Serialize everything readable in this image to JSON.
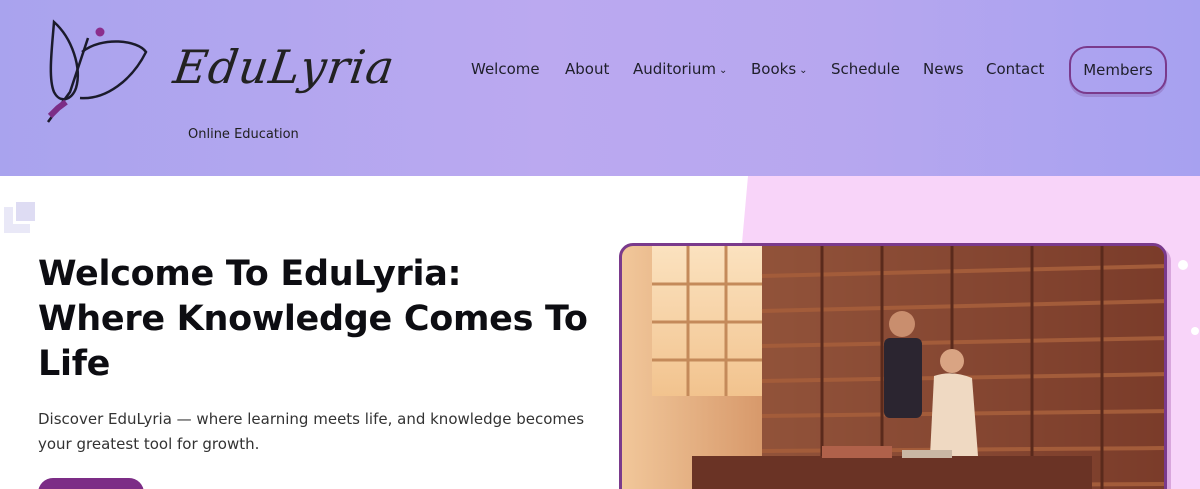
{
  "brand": {
    "name": "EduLyria",
    "tagline": "Online Education",
    "accent": "#7c2d86",
    "header_bg": "#b8a8f0",
    "hero_pink": "#f8d4f9"
  },
  "nav": {
    "items": [
      {
        "label": "Welcome",
        "dropdown": false
      },
      {
        "label": "About",
        "dropdown": false
      },
      {
        "label": "Auditorium",
        "dropdown": true
      },
      {
        "label": "Books",
        "dropdown": true
      },
      {
        "label": "Schedule",
        "dropdown": false
      },
      {
        "label": "News",
        "dropdown": false
      },
      {
        "label": "Contact",
        "dropdown": false
      }
    ],
    "members_label": "Members",
    "dropdown_icon": "chevron-down-icon"
  },
  "hero": {
    "title": "Welcome To EduLyria: Where Knowledge Comes To Life",
    "text": "Discover EduLyria — where learning meets life, and knowledge becomes your greatest tool for growth.",
    "image": "library-scene-illustration"
  }
}
